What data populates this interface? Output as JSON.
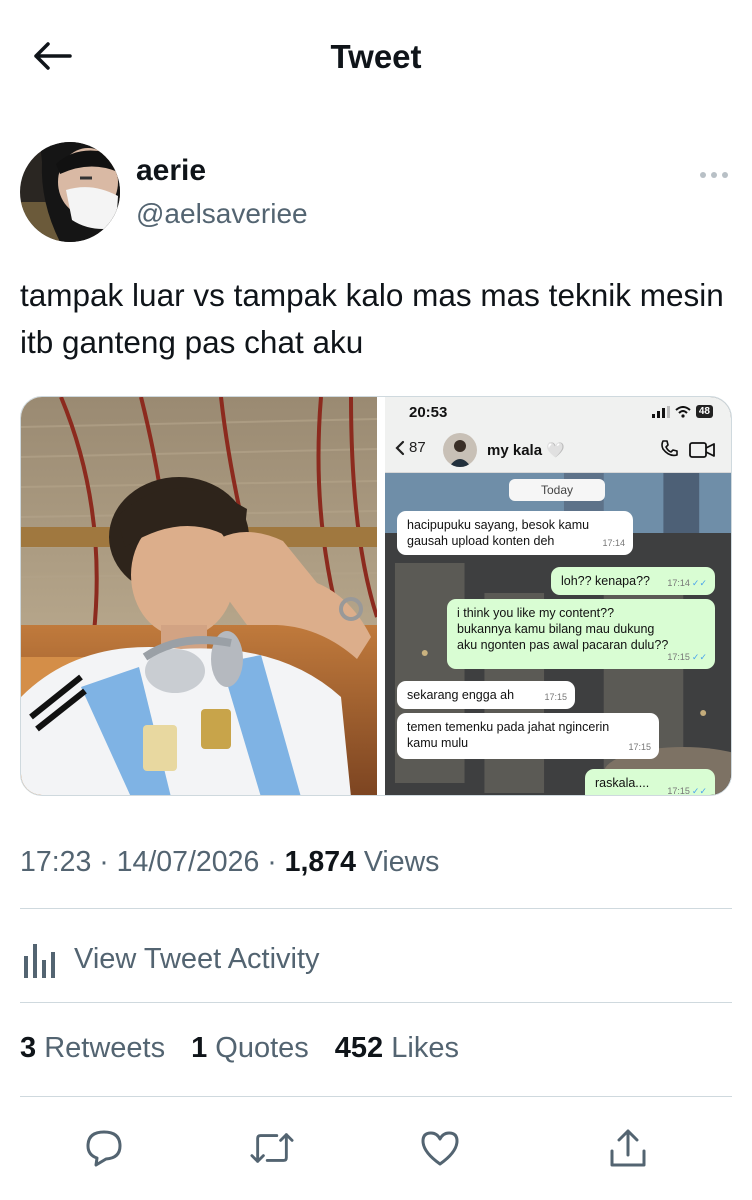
{
  "header": {
    "title": "Tweet",
    "back_icon": "arrow-left-icon"
  },
  "author": {
    "display_name": "aerie",
    "handle": "@aelsaveriee"
  },
  "tweet": {
    "text": "tampak luar vs tampak kalo mas mas teknik mesin itb ganteng pas chat aku"
  },
  "chat_screenshot": {
    "status_time": "20:53",
    "battery": "48",
    "back_count": "87",
    "contact_name": "my kala 🤍",
    "day_label": "Today",
    "messages": [
      {
        "dir": "in",
        "text_lines": [
          "hacipupuku sayang, besok kamu",
          "gausah upload konten deh"
        ],
        "time": "17:14"
      },
      {
        "dir": "out",
        "text_lines": [
          "loh?? kenapa??"
        ],
        "time": "17:14"
      },
      {
        "dir": "out",
        "text_lines": [
          "i think you like my content??",
          "bukannya kamu bilang mau dukung",
          "aku ngonten pas awal pacaran dulu??"
        ],
        "time": "17:15"
      },
      {
        "dir": "in",
        "text_lines": [
          "sekarang engga ah"
        ],
        "time": "17:15"
      },
      {
        "dir": "in",
        "text_lines": [
          "temen temenku pada jahat ngincerin",
          "kamu mulu"
        ],
        "time": "17:15"
      },
      {
        "dir": "out",
        "text_lines": [
          "raskala...."
        ],
        "time": "17:15"
      }
    ]
  },
  "meta": {
    "time": "17:23",
    "date": "14/07/2026",
    "views_count": "1,874",
    "views_label": "Views"
  },
  "activity": {
    "label": "View Tweet Activity"
  },
  "stats": {
    "retweets": {
      "count": "3",
      "label": "Retweets"
    },
    "quotes": {
      "count": "1",
      "label": "Quotes"
    },
    "likes": {
      "count": "452",
      "label": "Likes"
    }
  },
  "colors": {
    "text": "#0f1419",
    "secondary": "#536471",
    "divider": "#cfd9de",
    "bubble_out": "#d9fdd3"
  }
}
